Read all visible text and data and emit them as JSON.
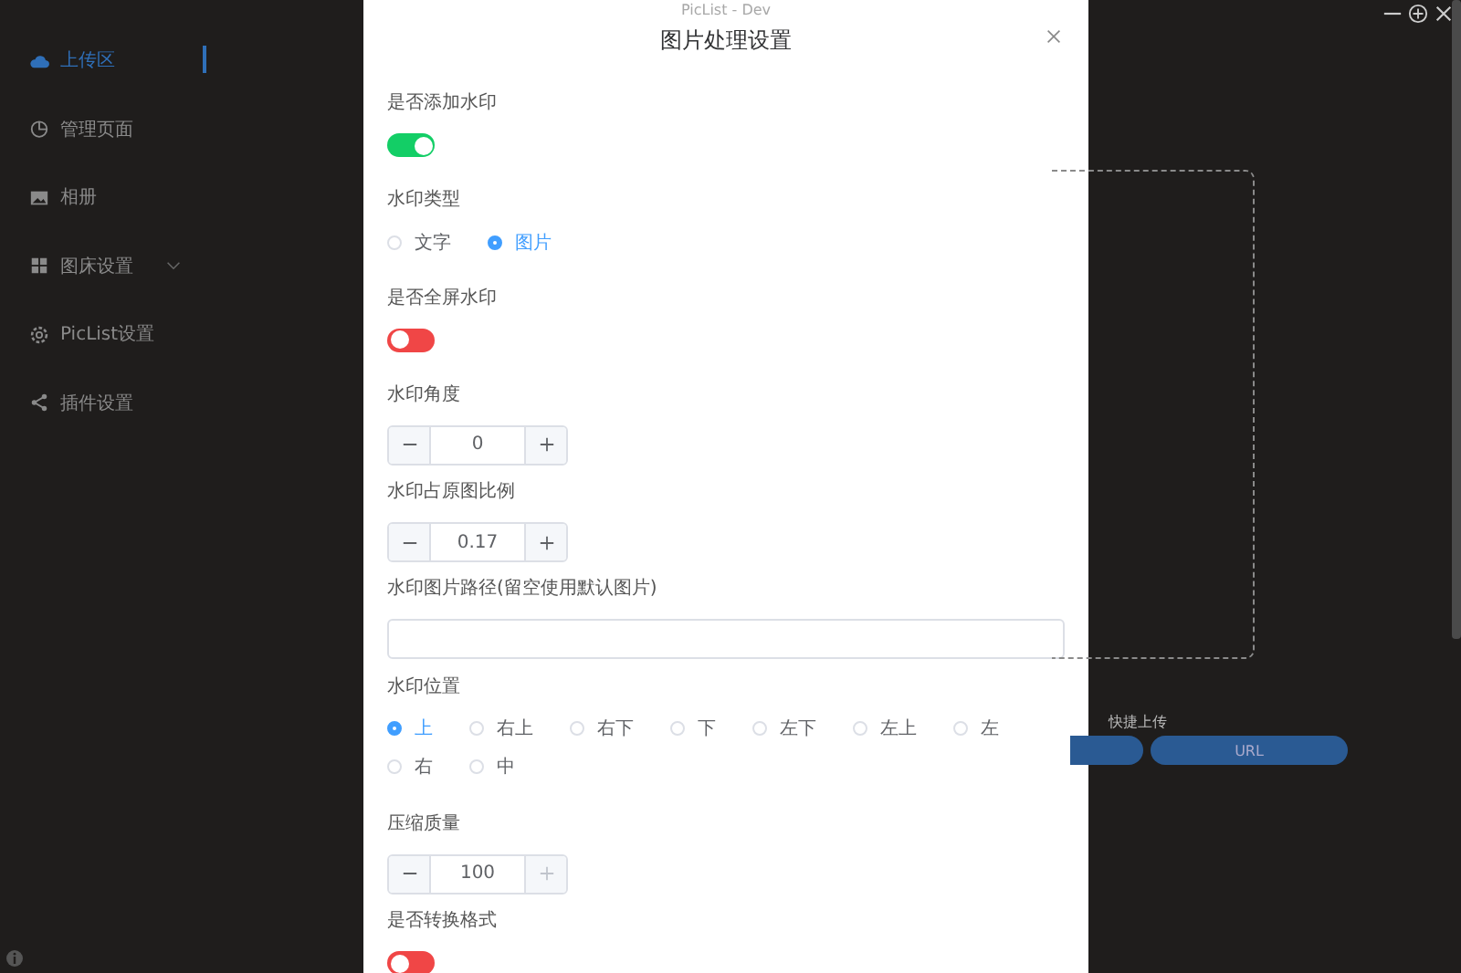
{
  "window": {
    "title": "PicList - Dev"
  },
  "sidebar": {
    "items": [
      {
        "label": "上传区",
        "selected": true
      },
      {
        "label": "管理页面",
        "selected": false
      },
      {
        "label": "相册",
        "selected": false
      },
      {
        "label": "图床设置",
        "selected": false,
        "expanded": false
      },
      {
        "label": "PicList设置",
        "selected": false
      },
      {
        "label": "插件设置",
        "selected": false
      }
    ]
  },
  "upload": {
    "label": "快捷上传",
    "buttons": [
      {
        "label": "URL"
      }
    ]
  },
  "dialog": {
    "title": "图片处理设置",
    "fields": [
      {
        "kind": "switch",
        "label": "是否添加水印",
        "on": true
      },
      {
        "kind": "radio",
        "label": "水印类型",
        "options": [
          {
            "label": "文字",
            "selected": false
          },
          {
            "label": "图片",
            "selected": true
          }
        ]
      },
      {
        "kind": "switch",
        "label": "是否全屏水印",
        "on": false
      },
      {
        "kind": "number",
        "label": "水印角度",
        "value": "0",
        "plus_disabled": false
      },
      {
        "kind": "number",
        "label": "水印占原图比例",
        "value": "0.17",
        "plus_disabled": false
      },
      {
        "kind": "text",
        "label": "水印图片路径(留空使用默认图片)"
      },
      {
        "kind": "radio",
        "label": "水印位置",
        "options": [
          {
            "label": "上",
            "selected": true
          },
          {
            "label": "右上",
            "selected": false
          },
          {
            "label": "右下",
            "selected": false
          },
          {
            "label": "下",
            "selected": false
          },
          {
            "label": "左下",
            "selected": false
          },
          {
            "label": "左上",
            "selected": false
          },
          {
            "label": "左",
            "selected": false
          },
          {
            "label": "右",
            "selected": false
          },
          {
            "label": "中",
            "selected": false
          }
        ]
      },
      {
        "kind": "number",
        "label": "压缩质量",
        "value": "100",
        "plus_disabled": true
      },
      {
        "kind": "switch",
        "label": "是否转换格式",
        "on": false
      }
    ]
  }
}
